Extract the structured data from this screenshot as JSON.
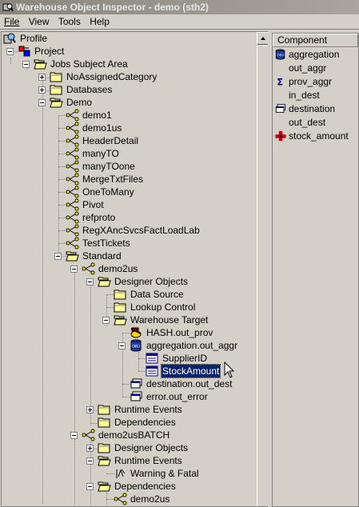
{
  "window": {
    "title": "Warehouse Object Inspector - demo (sth2)"
  },
  "menu": {
    "file": "File",
    "view": "View",
    "tools": "Tools",
    "help": "Help"
  },
  "tree": {
    "profile": "Profile",
    "project": "Project",
    "jobs_subject_area": "Jobs Subject Area",
    "no_assigned_category": "NoAssignedCategory",
    "databases": "Databases",
    "demo_category": "Demo",
    "demo_items": [
      "demo1",
      "demo1us",
      "HeaderDetail",
      "manyTO",
      "manyTOone",
      "MergeTxtFiles",
      "OneToMany",
      "Pivot",
      "refproto",
      "RegXAncSvcsFactLoadLab",
      "TestTickets"
    ],
    "standard": "Standard",
    "demo2us": "demo2us",
    "designer_objects": "Designer Objects",
    "data_source": "Data Source",
    "lookup_control": "Lookup Control",
    "warehouse_target": "Warehouse Target",
    "hash_out_prov": "HASH.out_prov",
    "aggregation_out_aggr": "aggregation.out_aggr",
    "supplier_id": "SupplierID",
    "stock_amount": "StockAmount",
    "destination_out_dest": "destination.out_dest",
    "error_out_error": "error.out_error",
    "runtime_events": "Runtime Events",
    "dependencies": "Dependencies",
    "demo2us_batch": "demo2usBATCH",
    "batch_designer_objects": "Designer Objects",
    "batch_runtime_events": "Runtime Events",
    "warning_fatal": "Warning & Fatal",
    "batch_dependencies": "Dependencies",
    "batch_demo2us": "demo2us"
  },
  "component_panel": {
    "header": "Component",
    "rows": [
      {
        "label": "aggregation",
        "icon": "object-icon"
      },
      {
        "label": "out_aggr",
        "icon": ""
      },
      {
        "label": "prov_aggr",
        "icon": "sigma-icon"
      },
      {
        "label": "in_dest",
        "icon": ""
      },
      {
        "label": "destination",
        "icon": "destination-icon"
      },
      {
        "label": "out_dest",
        "icon": ""
      },
      {
        "label": "stock_amount",
        "icon": "column-plus-icon"
      }
    ]
  },
  "colors": {
    "selection": "#0a246a",
    "titlebar": "#8a867e",
    "face": "#d4d0c8",
    "folder": "#ffff99"
  }
}
